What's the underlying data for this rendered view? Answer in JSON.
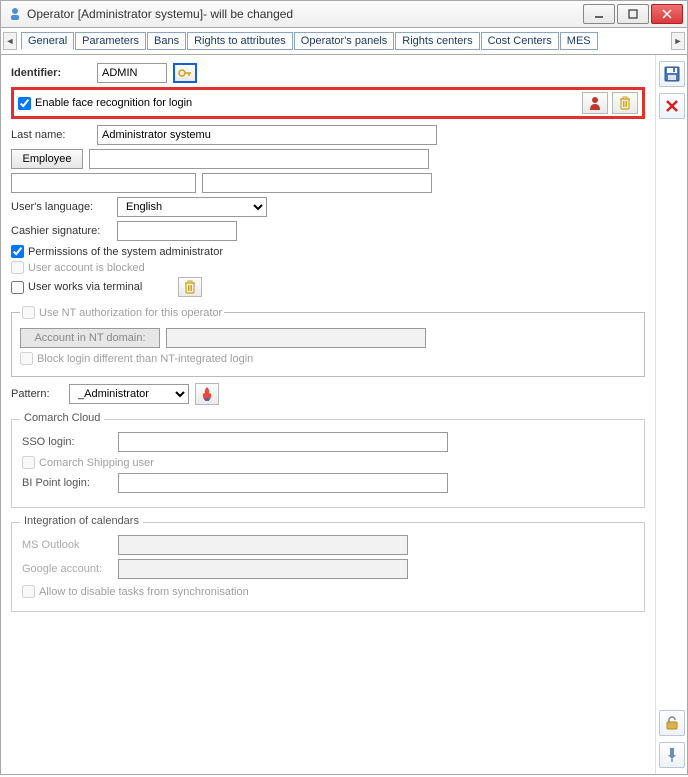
{
  "window": {
    "title": "Operator [Administrator systemu]- will be changed"
  },
  "tabs": [
    "General",
    "Parameters",
    "Bans",
    "Rights to attributes",
    "Operator's panels",
    "Rights centers",
    "Cost Centers",
    "MES"
  ],
  "fields": {
    "identifier_label": "Identifier:",
    "identifier_value": "ADMIN",
    "face_recognition": "Enable face recognition for login",
    "last_name_label": "Last name:",
    "last_name_value": "Administrator systemu",
    "employee_btn": "Employee",
    "user_lang_label": "User's language:",
    "user_lang_value": "English",
    "cashier_sig_label": "Cashier signature:",
    "perm_sysadmin": "Permissions of the system administrator",
    "acct_blocked": "User account is blocked",
    "terminal": "User works via terminal"
  },
  "nt": {
    "legend": "Use NT authorization for this operator",
    "acct_label": "Account in NT domain:",
    "block_login": "Block login different than NT-integrated login"
  },
  "pattern": {
    "label": "Pattern:",
    "value": "_Administrator"
  },
  "cloud": {
    "legend": "Comarch Cloud",
    "sso_label": "SSO login:",
    "shipping": "Comarch Shipping user",
    "bi_label": "BI Point login:"
  },
  "calendars": {
    "legend": "Integration of calendars",
    "outlook": "MS Outlook",
    "google": "Google account:",
    "allow_disable": "Allow to disable tasks from synchronisation"
  }
}
